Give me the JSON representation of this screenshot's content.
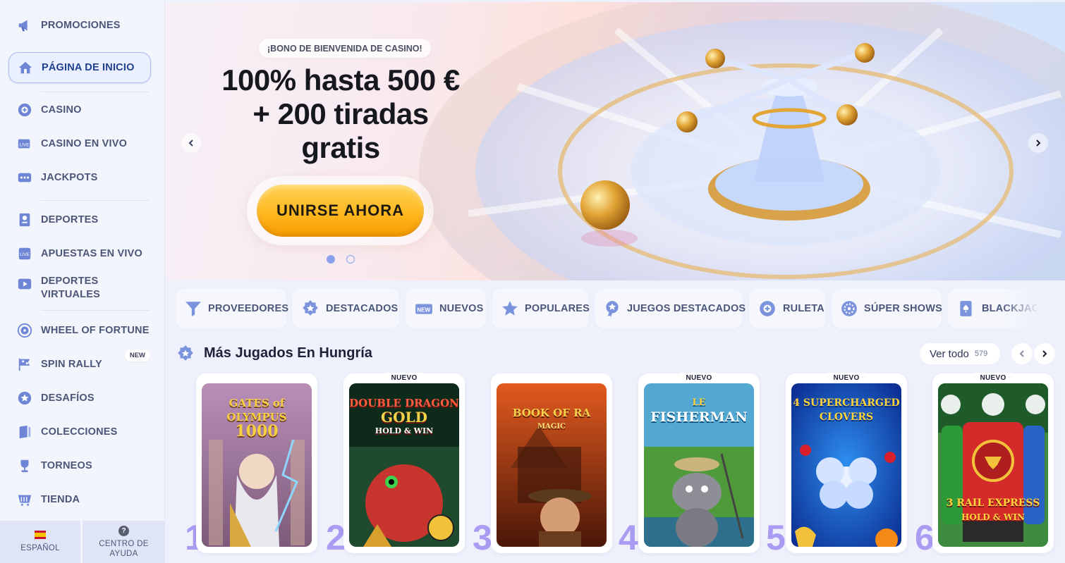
{
  "sidebar": {
    "items": [
      {
        "label": "PROMOCIONES",
        "icon": "megaphone-icon"
      },
      {
        "label": "PÁGINA DE INICIO",
        "icon": "home-icon"
      },
      {
        "label": "CASINO",
        "icon": "casino-chip-icon"
      },
      {
        "label": "CASINO EN VIVO",
        "icon": "live-casino-icon"
      },
      {
        "label": "JACKPOTS",
        "icon": "jackpot-icon"
      },
      {
        "label": "DEPORTES",
        "icon": "sports-icon"
      },
      {
        "label": "APUESTAS EN VIVO",
        "icon": "live-bets-icon"
      },
      {
        "label": "DEPORTES VIRTUALES",
        "icon": "virtual-sports-icon"
      },
      {
        "label": "WHEEL OF FORTUNE",
        "icon": "wheel-icon"
      },
      {
        "label": "SPIN RALLY",
        "icon": "flag-icon",
        "badge": "NEW"
      },
      {
        "label": "DESAFÍOS",
        "icon": "challenge-icon"
      },
      {
        "label": "COLECCIONES",
        "icon": "collections-icon"
      },
      {
        "label": "TORNEOS",
        "icon": "trophy-icon"
      },
      {
        "label": "TIENDA",
        "icon": "shop-icon"
      }
    ],
    "active_index": 1,
    "footer": {
      "language": "ESPAÑOL",
      "help": "CENTRO DE AYUDA",
      "help_glyph": "?"
    }
  },
  "hero": {
    "pill": "¡BONO DE BIENVENIDA DE CASINO!",
    "title_line1": "100% hasta 500 €",
    "title_line2": "+ 200 tiradas",
    "title_line3": "gratis",
    "cta": "UNIRSE AHORA",
    "slides": 2,
    "active_slide": 0
  },
  "categories": [
    {
      "label": "PROVEEDORES",
      "icon": "funnel-icon"
    },
    {
      "label": "DESTACADOS",
      "icon": "badge-star-icon"
    },
    {
      "label": "NUEVOS",
      "icon": "new-tag-icon"
    },
    {
      "label": "POPULARES",
      "icon": "star-icon"
    },
    {
      "label": "JUEGOS DESTACADOS",
      "icon": "medal-icon"
    },
    {
      "label": "RULETA",
      "icon": "roulette-icon"
    },
    {
      "label": "SÚPER SHOWS",
      "icon": "super-show-icon"
    },
    {
      "label": "BLACKJAC",
      "icon": "card-icon"
    }
  ],
  "section": {
    "title": "Más Jugados En Hungría",
    "view_all": "Ver todo",
    "count": "579"
  },
  "games": [
    {
      "rank": "1",
      "new": "",
      "name_line1": "GATES of OLYMPUS",
      "name_line2": "1000"
    },
    {
      "rank": "2",
      "new": "NUEVO",
      "name_line1": "DOUBLE DRAGON",
      "name_line2": "GOLD",
      "name_line3": "HOLD & WIN"
    },
    {
      "rank": "3",
      "new": "",
      "name_line1": "BOOK OF RA",
      "name_line2": "MAGIC"
    },
    {
      "rank": "4",
      "new": "NUEVO",
      "name_line1": "LE",
      "name_line2": "FISHERMAN"
    },
    {
      "rank": "5",
      "new": "NUEVO",
      "name_line1": "4 SUPERCHARGED",
      "name_line2": "CLOVERS"
    },
    {
      "rank": "6",
      "new": "NUEVO",
      "name_line1": "3 RAIL EXPRESS",
      "name_line2": "HOLD & WIN"
    }
  ],
  "colors": {
    "accent": "#1f3f8f",
    "rank_number": "#a99cf2",
    "cta_gold": "#ffb81f"
  }
}
